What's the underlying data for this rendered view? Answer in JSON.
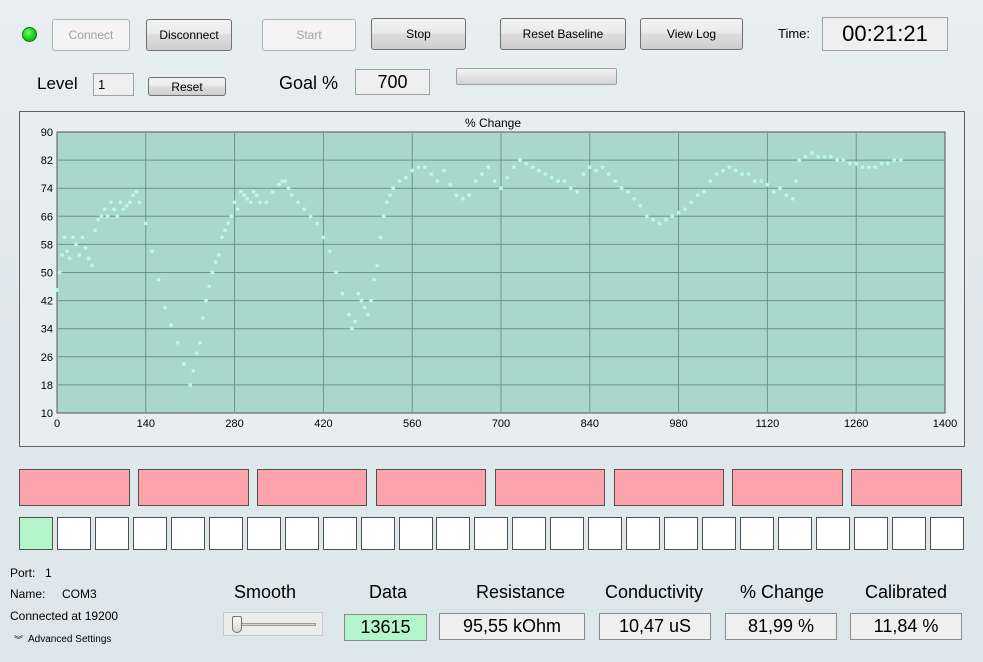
{
  "toolbar": {
    "connect_label": "Connect",
    "disconnect_label": "Disconnect",
    "start_label": "Start",
    "stop_label": "Stop",
    "reset_baseline_label": "Reset Baseline",
    "view_log_label": "View Log",
    "time_label": "Time:",
    "time_value": "00:21:21"
  },
  "level": {
    "label": "Level",
    "value": "1",
    "reset_label": "Reset"
  },
  "goal": {
    "label": "Goal %",
    "value": "700",
    "progress": 0.0
  },
  "chart_data": {
    "type": "scatter",
    "title": "% Change",
    "xlim": [
      0,
      1400
    ],
    "ylim": [
      10,
      90
    ],
    "x_ticks": [
      0,
      140,
      280,
      420,
      560,
      700,
      840,
      980,
      1120,
      1260,
      1400
    ],
    "y_ticks": [
      10,
      18,
      26,
      34,
      42,
      50,
      58,
      66,
      74,
      82,
      90
    ],
    "grid": true,
    "background": "#a9d7ca",
    "point_color": "#b8f8f1",
    "series": [
      {
        "x": [
          0,
          4,
          8,
          12,
          16,
          20,
          25,
          30,
          35,
          40,
          45,
          50,
          55,
          60,
          65,
          70,
          75,
          80,
          85,
          90,
          95,
          100,
          105,
          110,
          115,
          120,
          125,
          130,
          140,
          150,
          160,
          170,
          180,
          190,
          200,
          210,
          215,
          220,
          225,
          230,
          235,
          240,
          245,
          250,
          255,
          260,
          265,
          270,
          275,
          280,
          285,
          290,
          295,
          300,
          305,
          310,
          315,
          320,
          330,
          340,
          350,
          355,
          360,
          365,
          370,
          380,
          390,
          400,
          410,
          420,
          430,
          440,
          450,
          460,
          465,
          470,
          475,
          480,
          485,
          490,
          495,
          500,
          505,
          510,
          515,
          520,
          525,
          530,
          540,
          550,
          560,
          570,
          580,
          590,
          600,
          610,
          620,
          630,
          640,
          650,
          660,
          670,
          680,
          690,
          700,
          710,
          720,
          730,
          740,
          750,
          760,
          770,
          780,
          790,
          800,
          810,
          820,
          830,
          840,
          850,
          860,
          870,
          880,
          890,
          900,
          910,
          920,
          930,
          940,
          950,
          960,
          970,
          980,
          990,
          1000,
          1010,
          1020,
          1030,
          1040,
          1050,
          1060,
          1070,
          1080,
          1090,
          1100,
          1110,
          1120,
          1130,
          1140,
          1150,
          1160,
          1165,
          1170,
          1180,
          1190,
          1200,
          1210,
          1220,
          1230,
          1240,
          1250,
          1260,
          1270,
          1280,
          1290,
          1300,
          1310,
          1320,
          1330
        ],
        "y": [
          45,
          50,
          55,
          60,
          56,
          54,
          60,
          58,
          55,
          60,
          57,
          54,
          52,
          62,
          65,
          66,
          68,
          66,
          70,
          68,
          66,
          70,
          68,
          69,
          70,
          72,
          73,
          70,
          64,
          56,
          48,
          40,
          35,
          30,
          24,
          18,
          22,
          27,
          30,
          37,
          42,
          46,
          50,
          53,
          55,
          60,
          62,
          64,
          66,
          70,
          68,
          73,
          72,
          71,
          70,
          73,
          72,
          70,
          70,
          73,
          75,
          76,
          76,
          74,
          72,
          70,
          68,
          66,
          64,
          60,
          56,
          50,
          44,
          38,
          34,
          36,
          44,
          42,
          40,
          38,
          42,
          48,
          52,
          60,
          66,
          70,
          72,
          74,
          76,
          77,
          79,
          80,
          80,
          78,
          76,
          79,
          75,
          72,
          71,
          72,
          76,
          78,
          80,
          76,
          74,
          77,
          80,
          82,
          81,
          80,
          79,
          78,
          77,
          76,
          76,
          74,
          73,
          78,
          80,
          79,
          80,
          78,
          76,
          74,
          73,
          71,
          69,
          66,
          65,
          64,
          65,
          66,
          67,
          68,
          70,
          72,
          73,
          76,
          78,
          79,
          80,
          79,
          78,
          78,
          76,
          76,
          75,
          73,
          74,
          72,
          71,
          76,
          82,
          83,
          84,
          83,
          83,
          83,
          82,
          82,
          81,
          81,
          80,
          80,
          80,
          81,
          81,
          82,
          82
        ]
      }
    ]
  },
  "pink_blocks": 8,
  "squares": {
    "count": 25,
    "active_index": 0
  },
  "port": {
    "port_label": "Port:",
    "port_value": "1",
    "name_label": "Name:",
    "name_value": "COM3",
    "connected_text": "Connected at 19200",
    "advanced_label": "Advanced Settings"
  },
  "smooth": {
    "label": "Smooth",
    "value": 0
  },
  "readouts": {
    "data": {
      "label": "Data",
      "value": "13615"
    },
    "resistance": {
      "label": "Resistance",
      "value": "95,55 kOhm"
    },
    "conductivity": {
      "label": "Conductivity",
      "value": "10,47 uS"
    },
    "pct_change": {
      "label": "% Change",
      "value": "81,99 %"
    },
    "calibrated": {
      "label": "Calibrated",
      "value": "11,84 %"
    }
  },
  "colors": {
    "status_led": "#16d116",
    "pink_block": "#fca3ac",
    "active_square": "#b5f5cb"
  }
}
